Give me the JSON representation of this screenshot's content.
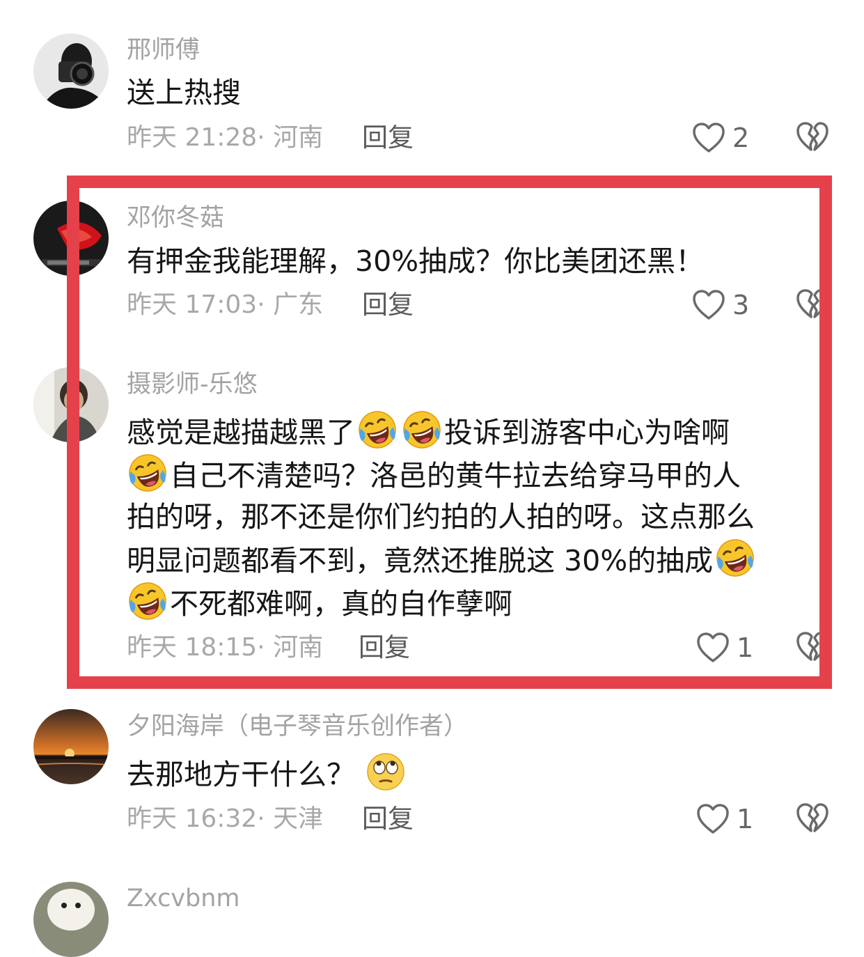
{
  "comments": [
    {
      "username": "邢师傅",
      "text": "送上热搜",
      "time": "昨天 21:28",
      "location": "河南",
      "reply_label": "回复",
      "likes": "2"
    },
    {
      "username": "邓你冬菇",
      "text": "有押金我能理解，30%抽成？你比美团还黑！",
      "time": "昨天 17:03",
      "location": "广东",
      "reply_label": "回复",
      "likes": "3"
    },
    {
      "username": "摄影师-乐悠",
      "text_lines": [
        "感觉是越描越黑了",
        "投诉到游客中心为啥啊",
        "自己不清楚吗？洛邑的黄牛拉去给穿马甲的人",
        "拍的呀，那不还是你们约拍的人拍的呀。这点那么",
        "明显问题都看不到，竟然还推脱这 30%的抽成",
        "不死都难啊，真的自作孽啊"
      ],
      "time": "昨天 18:15",
      "location": "河南",
      "reply_label": "回复",
      "likes": "1"
    },
    {
      "username": "夕阳海岸（电子琴音乐创作者）",
      "text": "去那地方干什么？",
      "time": "昨天 16:32",
      "location": "天津",
      "reply_label": "回复",
      "likes": "1"
    },
    {
      "username": "Zxcvbnm"
    }
  ],
  "icons": {
    "like": "heart-outline-icon",
    "dislike": "broken-heart-icon",
    "laugh_emoji": "tears-of-joy-emoji",
    "eyeroll_emoji": "eye-roll-emoji"
  },
  "colors": {
    "highlight_border": "#e5414b",
    "username": "#a3a3a3",
    "meta": "#a8a8a8",
    "body_text": "#161616"
  }
}
